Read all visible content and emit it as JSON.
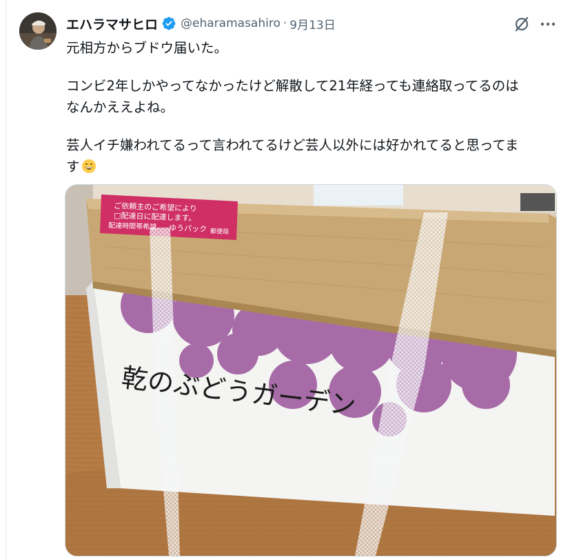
{
  "tweet": {
    "author": {
      "display_name": "エハラマサヒロ",
      "handle": "@eharamasahiro",
      "verified": true,
      "verified_color": "#1d9bf0"
    },
    "separator": "·",
    "date": "9月13日",
    "text_lines": [
      "元相方からブドウ届いた。",
      "",
      "コンビ2年しかやってなかったけど解散して21年経っても連絡取ってるのは",
      "なんかええよね。",
      "",
      "芸人イチ嫌われてるって言われてるけど芸人以外には好かれてると思ってま",
      "す"
    ],
    "emoji": "grinning-face-with-smiling-eyes",
    "media": {
      "box_print": "乾のぶどうガーデン",
      "sticker_lines": [
        "ご依頼主のご希望により",
        "□配達日に配達します。",
        "配達時間帯希望",
        "ゆうパック",
        "郵便局"
      ]
    },
    "icons": {
      "grok": "grok-icon",
      "more": "more-icon"
    }
  }
}
